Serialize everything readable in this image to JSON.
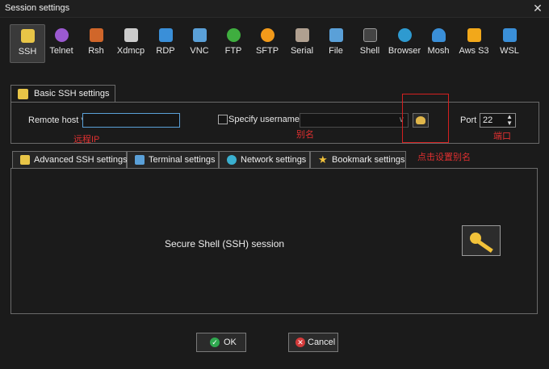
{
  "window": {
    "title": "Session settings",
    "close_glyph": "✕"
  },
  "protocols": [
    {
      "label": "SSH",
      "icon": "ssh-key-icon",
      "color": "#e8c547",
      "active": true
    },
    {
      "label": "Telnet",
      "icon": "telnet-icon",
      "color": "#9b59d0"
    },
    {
      "label": "Rsh",
      "icon": "rsh-icon",
      "color": "#d0662a"
    },
    {
      "label": "Xdmcp",
      "icon": "xdmcp-icon",
      "color": "#cccccc"
    },
    {
      "label": "RDP",
      "icon": "rdp-icon",
      "color": "#3a8fd8"
    },
    {
      "label": "VNC",
      "icon": "vnc-icon",
      "color": "#5aa0d8"
    },
    {
      "label": "FTP",
      "icon": "ftp-icon",
      "color": "#3fae3f"
    },
    {
      "label": "SFTP",
      "icon": "sftp-icon",
      "color": "#f29a1a"
    },
    {
      "label": "Serial",
      "icon": "serial-icon",
      "color": "#b0a090"
    },
    {
      "label": "File",
      "icon": "file-icon",
      "color": "#5aa0d8"
    },
    {
      "label": "Shell",
      "icon": "shell-icon",
      "color": "#444444"
    },
    {
      "label": "Browser",
      "icon": "browser-icon",
      "color": "#2e9ad0"
    },
    {
      "label": "Mosh",
      "icon": "mosh-icon",
      "color": "#3a8fd8"
    },
    {
      "label": "Aws S3",
      "icon": "aws-s3-icon",
      "color": "#f2a81a"
    },
    {
      "label": "WSL",
      "icon": "wsl-icon",
      "color": "#3a8fd8"
    }
  ],
  "basic": {
    "tab_label": "Basic SSH settings",
    "remote_host_label": "Remote host *",
    "remote_host_value": "",
    "specify_username_label": "Specify username",
    "username_value": "",
    "port_label": "Port",
    "port_value": "22"
  },
  "annotations": {
    "remote_ip": "远程IP",
    "alias": "别名",
    "port": "端口",
    "click_set_alias": "点击设置别名"
  },
  "tabs": [
    {
      "label": "Advanced SSH settings",
      "icon": "key-icon",
      "color": "#e8c547"
    },
    {
      "label": "Terminal settings",
      "icon": "terminal-icon",
      "color": "#5aa0d8"
    },
    {
      "label": "Network settings",
      "icon": "network-icon",
      "color": "#3ab0d0"
    },
    {
      "label": "Bookmark settings",
      "icon": "star-icon",
      "color": "#f2c23a"
    }
  ],
  "panel": {
    "description": "Secure Shell (SSH) session"
  },
  "buttons": {
    "ok": "OK",
    "cancel": "Cancel"
  },
  "colors": {
    "accent_red": "#e03030",
    "ok_green": "#2fa84f",
    "cancel_red": "#d33a3a"
  }
}
